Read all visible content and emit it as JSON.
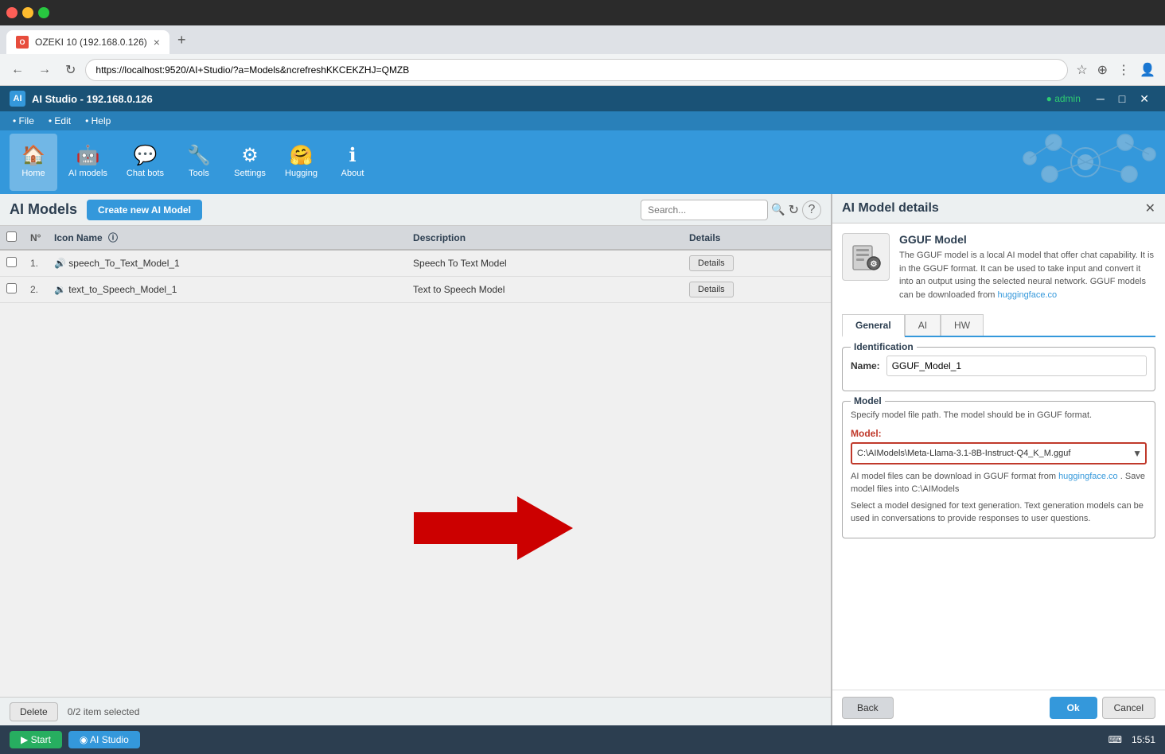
{
  "browser": {
    "tab_title": "OZEKI 10 (192.168.0.126)",
    "address": "https://localhost:9520/AI+Studio/?a=Models&ncrefreshKKCEKZHJ=QMZB",
    "new_tab_label": "+"
  },
  "app": {
    "title": "AI Studio - 192.168.0.126",
    "admin_label": "● admin"
  },
  "menu": {
    "items": [
      "• File",
      "• Edit",
      "• Help"
    ]
  },
  "toolbar": {
    "buttons": [
      {
        "id": "home",
        "icon": "🏠",
        "label": "Home"
      },
      {
        "id": "ai_models",
        "icon": "🤖",
        "label": "AI models"
      },
      {
        "id": "chat_bots",
        "icon": "💬",
        "label": "Chat bots"
      },
      {
        "id": "tools",
        "icon": "🔧",
        "label": "Tools"
      },
      {
        "id": "settings",
        "icon": "⚙",
        "label": "Settings"
      },
      {
        "id": "hugging",
        "icon": "🤗",
        "label": "Hugging"
      },
      {
        "id": "about",
        "icon": "ℹ",
        "label": "About"
      }
    ]
  },
  "left_panel": {
    "title": "AI Models",
    "create_button": "Create new AI Model",
    "search_placeholder": "Search...",
    "table": {
      "columns": [
        "",
        "N°",
        "Icon Name",
        "Description",
        "Details"
      ],
      "rows": [
        {
          "num": "1.",
          "icon": "🔊",
          "name": "speech_To_Text_Model_1",
          "description": "Speech To Text Model",
          "details_label": "Details"
        },
        {
          "num": "2.",
          "icon": "🔉",
          "name": "text_to_Speech_Model_1",
          "description": "Text to Speech Model",
          "details_label": "Details"
        }
      ]
    },
    "delete_button": "Delete",
    "selection_status": "0/2 item selected"
  },
  "right_panel": {
    "title": "AI Model details",
    "gguf_title": "GGUF Model",
    "gguf_description": "The GGUF model is a local AI model that offer chat capability. It is in the GGUF format. It can be used to take input and convert it into an output using the selected neural network. GGUF models can be downloaded from",
    "gguf_link_text": "huggingface.co",
    "tabs": [
      "General",
      "AI",
      "HW"
    ],
    "active_tab": "General",
    "identification": {
      "section_label": "Identification",
      "name_label": "Name:",
      "name_value": "GGUF_Model_1"
    },
    "model_section": {
      "section_label": "Model",
      "description": "Specify model file path. The model should be in GGUF format.",
      "field_label": "Model:",
      "field_value": "C:\\AIModels\\Meta-Llama-3.1-8B-Instruct-Q4_K_M.gguf",
      "info1": "AI model files can be download in GGUF format from",
      "info1_link": "huggingface.co",
      "info1_suffix": ". Save model files into C:\\AIModels",
      "info2": "Select a model designed for text generation. Text generation models can be used in conversations to provide responses to user questions."
    },
    "buttons": {
      "back": "Back",
      "ok": "Ok",
      "cancel": "Cancel"
    }
  },
  "status_bar": {
    "start_label": "▶ Start",
    "ai_studio_label": "◉ AI Studio",
    "time": "15:51",
    "keyboard_icon": "⌨"
  }
}
